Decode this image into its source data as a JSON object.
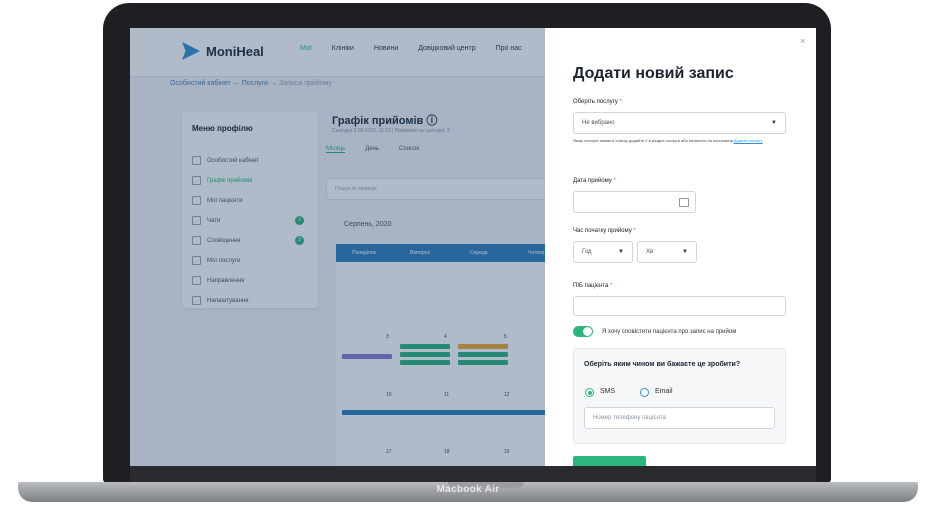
{
  "device": {
    "label": "Macbook Air"
  },
  "app": {
    "logo_text": "MoniHeal",
    "nav": [
      "Мої",
      "Клініки",
      "Новини",
      "Довідковий центр",
      "Про нас"
    ],
    "breadcrumb": [
      "Особистий кабінет",
      "→",
      "Послуги",
      "→",
      "Записи прийому"
    ],
    "profile_menu": {
      "title": "Меню профілю",
      "items": [
        {
          "label": "Особистий кабінет",
          "count": ""
        },
        {
          "label": "Графік прийомів",
          "count": ""
        },
        {
          "label": "Мої пацієнти",
          "count": ""
        },
        {
          "label": "Чати",
          "count": "2"
        },
        {
          "label": "Сповіщення",
          "count": "3"
        },
        {
          "label": "Мої послуги",
          "count": ""
        },
        {
          "label": "Направлення",
          "count": ""
        },
        {
          "label": "Налаштування",
          "count": ""
        }
      ]
    },
    "calendar": {
      "title": "Графік прийомів ⓘ",
      "subtitle": "Сьогодні 3.08.2020, 11:15 | Прийомів на сьогодні: 3",
      "tabs": [
        "Місяць",
        "День",
        "Список"
      ],
      "search_placeholder": "Пошук по записах",
      "month_label": "Серпень, 2020",
      "weekdays": [
        "Понеділок",
        "Вівторок",
        "Середа",
        "Четвер"
      ],
      "day_numbers": [
        "3",
        "4",
        "5",
        "10",
        "11",
        "12",
        "17",
        "18",
        "19"
      ]
    }
  },
  "modal": {
    "close_label": "×",
    "title": "Додати новий запис",
    "service_label": "Оберіть послугу",
    "required_mark": "*",
    "service_value": "Не вибрано",
    "service_hint": "Якщо послуги немає в списку додайте її в розділі послуги або натисніть на посилання",
    "service_hint_link": "Додати послугу",
    "date_label": "Дата прийому",
    "time_label": "Час початку прийому",
    "hour_value": "Год",
    "minute_value": "Хв",
    "name_label": "ПІБ пацієнта",
    "toggle_label": "Я хочу сповістити пацієнта про запис на прийом",
    "notify_question": "Оберіть яким чином ви бажаєте це зробити?",
    "option_sms": "SMS",
    "option_email": "Email",
    "phone_placeholder": "Номер телефону пацієнта"
  },
  "colors": {
    "accent_green": "#2cb67d",
    "accent_blue": "#2f7fbd",
    "bezel": "#1e1f22"
  }
}
